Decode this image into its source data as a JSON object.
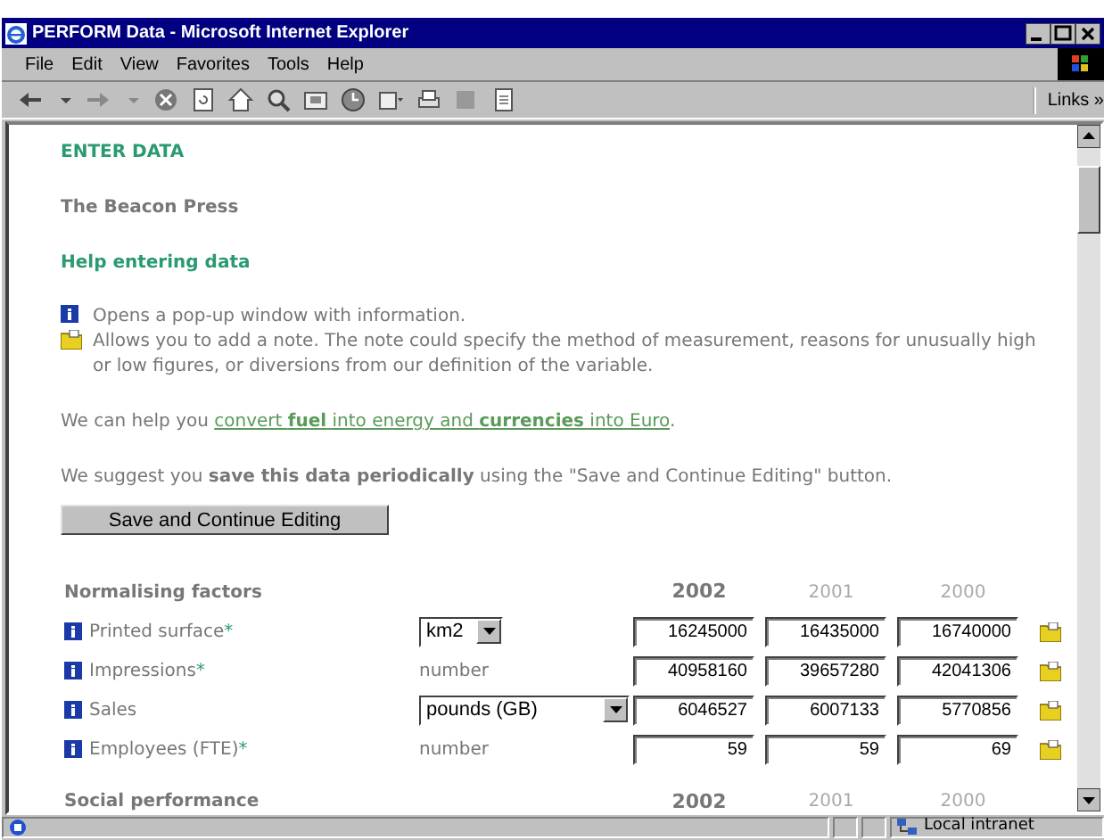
{
  "window": {
    "title": "PERFORM Data - Microsoft Internet Explorer"
  },
  "menu": [
    "File",
    "Edit",
    "View",
    "Favorites",
    "Tools",
    "Help"
  ],
  "toolbar": {
    "links_label": "Links »"
  },
  "page": {
    "heading": "ENTER DATA",
    "organisation": "The Beacon Press",
    "help_heading": "Help entering data",
    "help_items": [
      {
        "kind": "info",
        "text": "Opens a pop-up window with information."
      },
      {
        "kind": "note",
        "text": "Allows you to add a note. The note could specify the method of measurement, reasons for unusually high or low figures, or diversions from our definition of the variable."
      }
    ],
    "convert": {
      "before": "We can help you ",
      "link": "convert **fuel** into energy and **currencies** into Euro",
      "after": "."
    },
    "suggest": "We suggest you **save this data periodically** using the \"Save and Continue Editing\" button.",
    "save_button": "Save and Continue Editing",
    "sections": [
      {
        "title": "Normalising factors",
        "years": [
          {
            "label": "2002",
            "current": true
          },
          {
            "label": "2001",
            "current": false
          },
          {
            "label": "2000",
            "current": false
          }
        ],
        "rows": [
          {
            "label": "Printed surface",
            "mark": "*",
            "unit": {
              "kind": "select",
              "value": "km2"
            },
            "values": [
              "16245000",
              "16435000",
              "16740000"
            ]
          },
          {
            "label": "Impressions",
            "mark": "*",
            "unit": {
              "kind": "text",
              "value": "number"
            },
            "values": [
              "40958160",
              "39657280",
              "42041306"
            ]
          },
          {
            "label": "Sales",
            "unit": {
              "kind": "select",
              "value": "pounds (GB)"
            },
            "values": [
              "6046527",
              "6007133",
              "5770856"
            ]
          },
          {
            "label": "Employees (FTE)",
            "mark": "*",
            "unit": {
              "kind": "text",
              "value": "number"
            },
            "values": [
              "59",
              "59",
              "69"
            ]
          }
        ]
      },
      {
        "title": "Social performance",
        "years": [
          {
            "label": "2002",
            "current": true
          },
          {
            "label": "2001",
            "current": false
          },
          {
            "label": "2000",
            "current": false
          }
        ]
      }
    ]
  },
  "status_bar": {
    "zone": "Local intranet"
  }
}
